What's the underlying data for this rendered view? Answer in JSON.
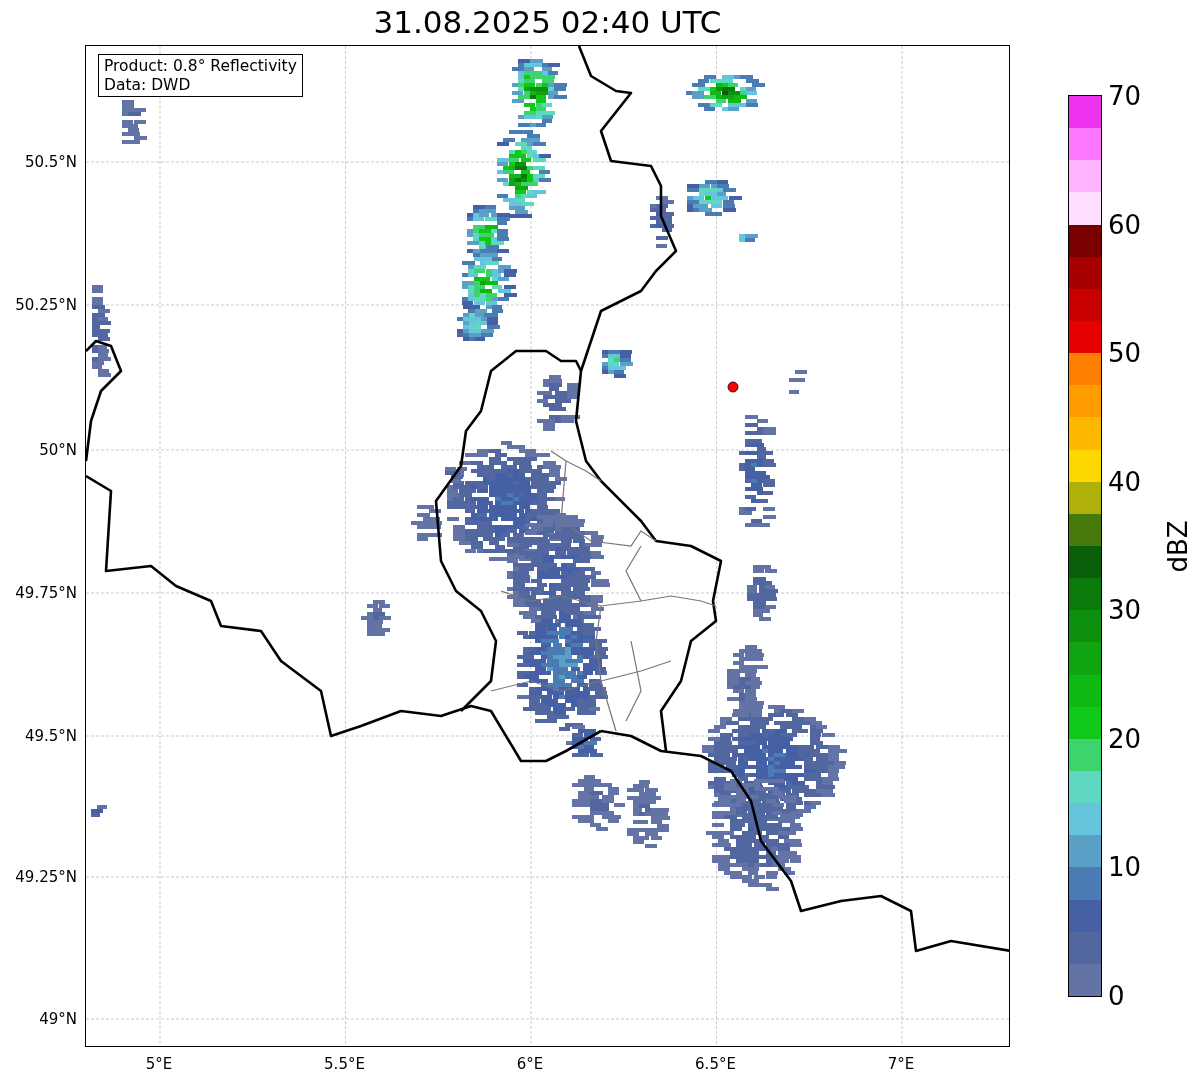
{
  "title": "31.08.2025 02:40 UTC",
  "info_box": [
    "Product: 0.8° Reflectivity",
    "Data: DWD"
  ],
  "map": {
    "yticks": [
      "50.5°N",
      "50.25°N",
      "50°N",
      "49.75°N",
      "49.5°N",
      "49.25°N",
      "49°N"
    ],
    "xticks": [
      "5°E",
      "5.5°E",
      "6°E",
      "6.5°E",
      "7°E"
    ]
  },
  "colorbar": {
    "label": "dBZ",
    "ticks": [
      "70",
      "60",
      "50",
      "40",
      "30",
      "20",
      "10",
      "0"
    ],
    "levels": [
      {
        "color": "#ee33ee"
      },
      {
        "color": "#ff77ff"
      },
      {
        "color": "#ffb3ff"
      },
      {
        "color": "#ffdfff"
      },
      {
        "color": "#7a0000"
      },
      {
        "color": "#a80000"
      },
      {
        "color": "#c80000"
      },
      {
        "color": "#e60000"
      },
      {
        "color": "#ff7f00"
      },
      {
        "color": "#ff9c00"
      },
      {
        "color": "#ffb800"
      },
      {
        "color": "#ffd700"
      },
      {
        "color": "#b0b00a"
      },
      {
        "color": "#477a0a"
      },
      {
        "color": "#0a5e0a"
      },
      {
        "color": "#0a7a0a"
      },
      {
        "color": "#0e8f0e"
      },
      {
        "color": "#10a510"
      },
      {
        "color": "#10b814"
      },
      {
        "color": "#10c81a"
      },
      {
        "color": "#3dd46e"
      },
      {
        "color": "#5fd8c2"
      },
      {
        "color": "#65c5dc"
      },
      {
        "color": "#5aa0c6"
      },
      {
        "color": "#4a7bb3"
      },
      {
        "color": "#4560a4"
      },
      {
        "color": "#5267a0"
      },
      {
        "color": "#6373a5"
      }
    ]
  }
}
